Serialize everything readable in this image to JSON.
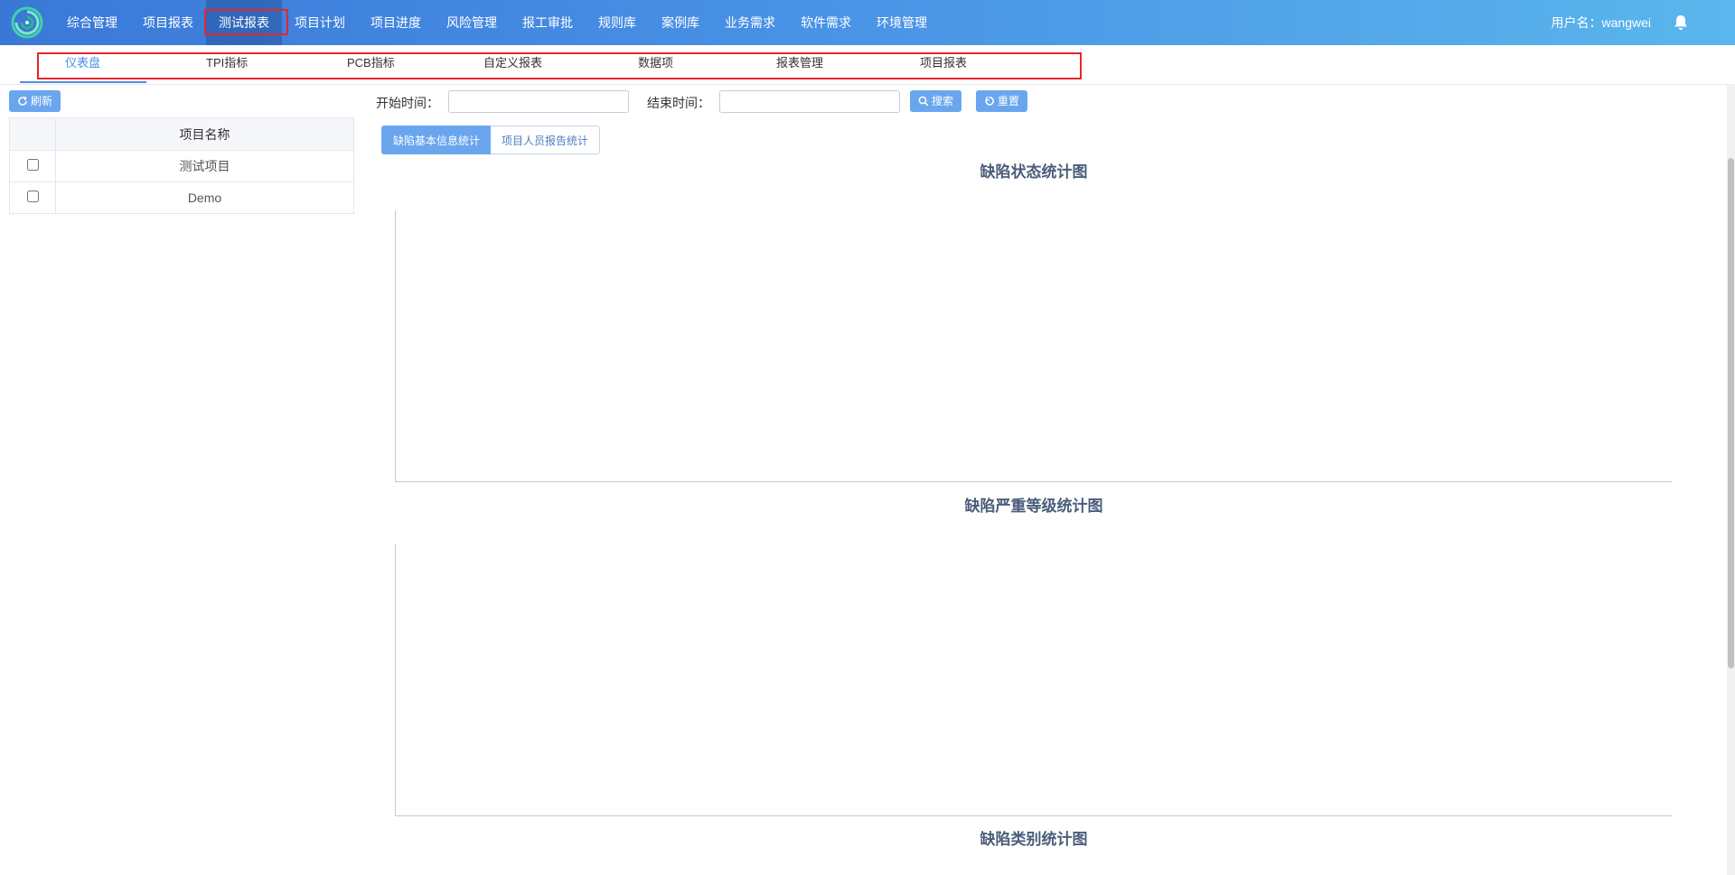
{
  "header": {
    "nav": [
      "综合管理",
      "项目报表",
      "测试报表",
      "项目计划",
      "项目进度",
      "风险管理",
      "报工审批",
      "规则库",
      "案例库",
      "业务需求",
      "软件需求",
      "环境管理"
    ],
    "active_nav": "测试报表",
    "user_label": "用户名：wangwei"
  },
  "subnav": {
    "items": [
      "仪表盘",
      "TPI指标",
      "PCB指标",
      "自定义报表",
      "数据项",
      "报表管理",
      "项目报表"
    ],
    "active": "仪表盘"
  },
  "sidebar": {
    "refresh_label": "刷新",
    "table_header": "项目名称",
    "rows": [
      {
        "name": "测试项目",
        "checked": false
      },
      {
        "name": "Demo",
        "checked": false
      }
    ]
  },
  "filters": {
    "start_label": "开始时间：",
    "start_value": "",
    "end_label": "结束时间：",
    "end_value": "",
    "search_label": "搜索",
    "reset_label": "重置"
  },
  "tabs": {
    "items": [
      "缺陷基本信息统计",
      "项目人员报告统计"
    ],
    "active": "缺陷基本信息统计"
  },
  "charts": {
    "status_title": "缺陷状态统计图",
    "severity_title": "缺陷严重等级统计图",
    "category_title": "缺陷类别统计图"
  },
  "colors": {
    "header_gradient_start": "#3a78d8",
    "header_gradient_end": "#5ab6ec",
    "accent": "#4a90e2",
    "button": "#6aa6ee",
    "highlight_box": "#e5262d"
  }
}
